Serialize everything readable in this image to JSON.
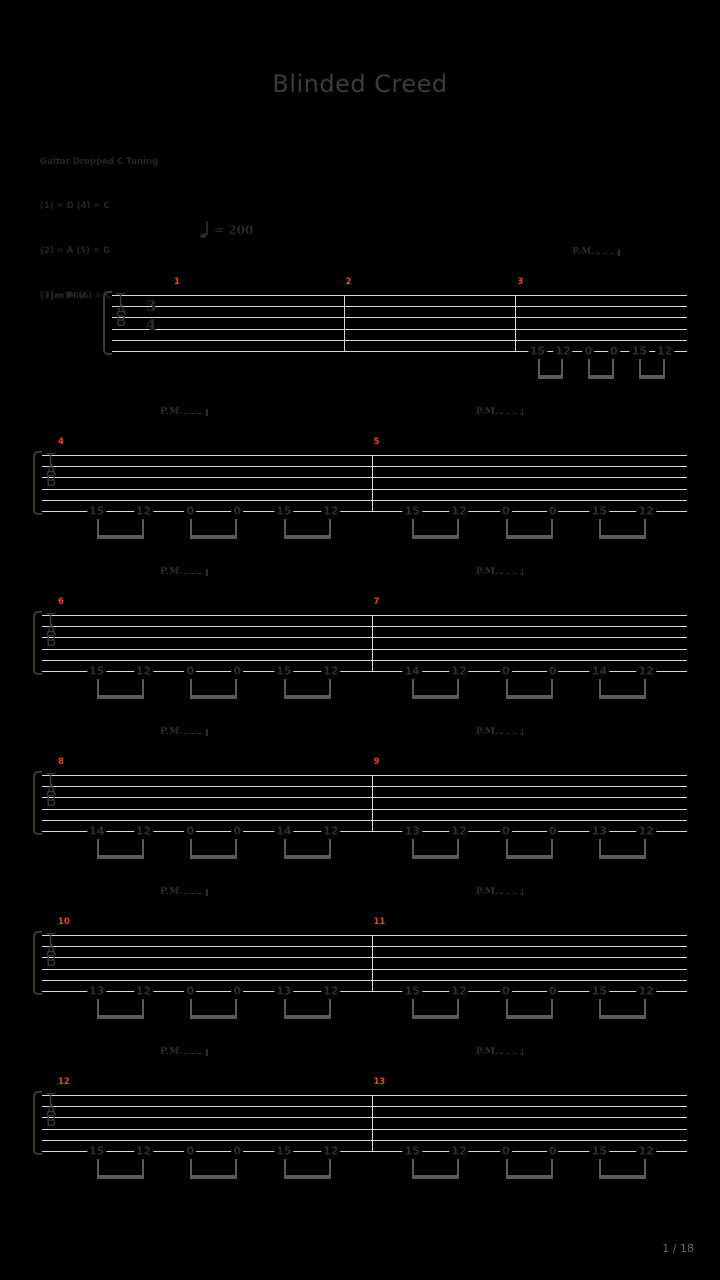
{
  "document": {
    "title": "Blinded Creed",
    "page_label": "1 / 18"
  },
  "tuning": {
    "heading": "Guitar Dropped C Tuning",
    "line1": "(1) = D (4) = C",
    "line2": "(2) = A (5) = G",
    "line3": "(3) = F  (6) = C"
  },
  "tempo": {
    "marking": "= 200",
    "note_icon": "quarter-note-icon"
  },
  "score": {
    "instrument_name": "Jan?Misi",
    "tab_clef": "TAB",
    "time_signature_top": "3",
    "time_signature_bottom": "4",
    "palm_mute_label": "P.M.",
    "systems": [
      {
        "measures": [
          {
            "number": "1",
            "notes": []
          },
          {
            "number": "2",
            "notes": []
          },
          {
            "number": "3",
            "notes": [
              "15",
              "12",
              "0",
              "0",
              "15",
              "12"
            ]
          }
        ]
      },
      {
        "measures": [
          {
            "number": "4",
            "notes": [
              "15",
              "12",
              "0",
              "0",
              "15",
              "12"
            ]
          },
          {
            "number": "5",
            "notes": [
              "15",
              "12",
              "0",
              "0",
              "15",
              "12"
            ]
          }
        ]
      },
      {
        "measures": [
          {
            "number": "6",
            "notes": [
              "15",
              "12",
              "0",
              "0",
              "15",
              "12"
            ]
          },
          {
            "number": "7",
            "notes": [
              "14",
              "12",
              "0",
              "0",
              "14",
              "12"
            ]
          }
        ]
      },
      {
        "measures": [
          {
            "number": "8",
            "notes": [
              "14",
              "12",
              "0",
              "0",
              "14",
              "12"
            ]
          },
          {
            "number": "9",
            "notes": [
              "13",
              "12",
              "0",
              "0",
              "13",
              "12"
            ]
          }
        ]
      },
      {
        "measures": [
          {
            "number": "10",
            "notes": [
              "13",
              "12",
              "0",
              "0",
              "13",
              "12"
            ]
          },
          {
            "number": "11",
            "notes": [
              "15",
              "12",
              "0",
              "0",
              "15",
              "12"
            ]
          }
        ]
      },
      {
        "measures": [
          {
            "number": "12",
            "notes": [
              "15",
              "12",
              "0",
              "0",
              "15",
              "12"
            ]
          },
          {
            "number": "13",
            "notes": [
              "15",
              "12",
              "0",
              "0",
              "15",
              "12"
            ]
          }
        ]
      }
    ]
  },
  "colors": {
    "background": "#000000",
    "title": "#3c3c3c",
    "measure_number": "#e8491d",
    "staff_line": "#d8d8d8",
    "fret_number": "#2d2d2d",
    "bracket": "#3a3d20"
  }
}
